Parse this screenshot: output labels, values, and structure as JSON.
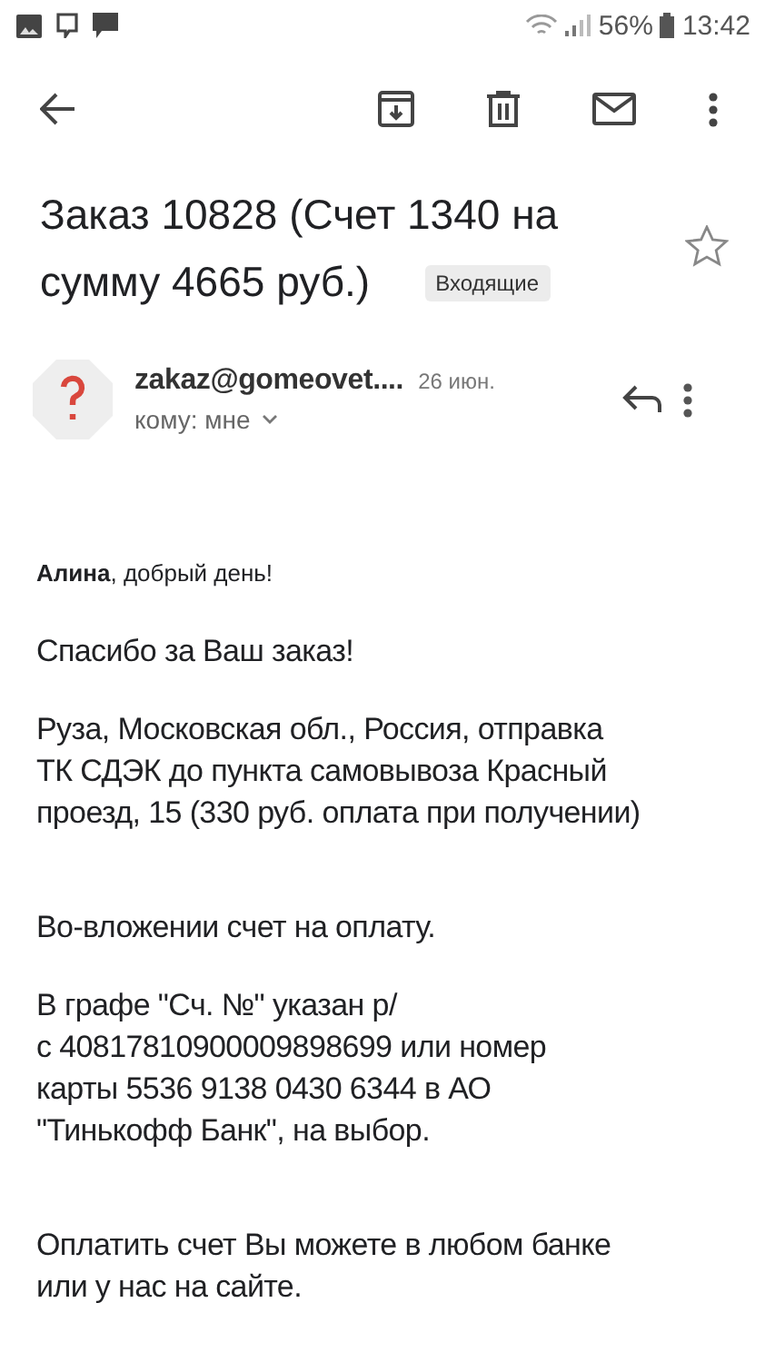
{
  "status_bar": {
    "battery": "56%",
    "time": "13:42"
  },
  "subject": {
    "lines": [
      "Заказ 10828 (Счет 1340 на",
      "сумму 4665 руб.)"
    ],
    "label": "Входящие",
    "starred": false
  },
  "sender": {
    "address": "zakaz@gomeovet....",
    "date": "26 июн.",
    "recipient": "кому: мне"
  },
  "body": [
    {
      "kind": "greeting",
      "lines": [
        "**Алина**, добрый день!"
      ]
    },
    {
      "kind": "paragraph",
      "lines": [
        "Спасибо за Ваш заказ!"
      ]
    },
    {
      "kind": "paragraph",
      "lines": [
        "Руза, Московская обл., Россия, отправка",
        "ТК СДЭК до пункта самовывоза Красный",
        "проезд, 15 (330 руб. оплата при получении)"
      ]
    },
    {
      "kind": "gap"
    },
    {
      "kind": "paragraph",
      "lines": [
        "Во-вложении счет на оплату."
      ]
    },
    {
      "kind": "paragraph",
      "lines": [
        "В графе \"Сч. №\" указан р/",
        "с 40817810900009898699 или номер",
        "карты 5536 9138 0430 6344 в АО",
        "\"Тинькофф Банк\", на выбор."
      ]
    },
    {
      "kind": "gap"
    },
    {
      "kind": "paragraph",
      "lines": [
        "Оплатить счет Вы можете в любом банке",
        "или у нас на сайте."
      ]
    }
  ]
}
